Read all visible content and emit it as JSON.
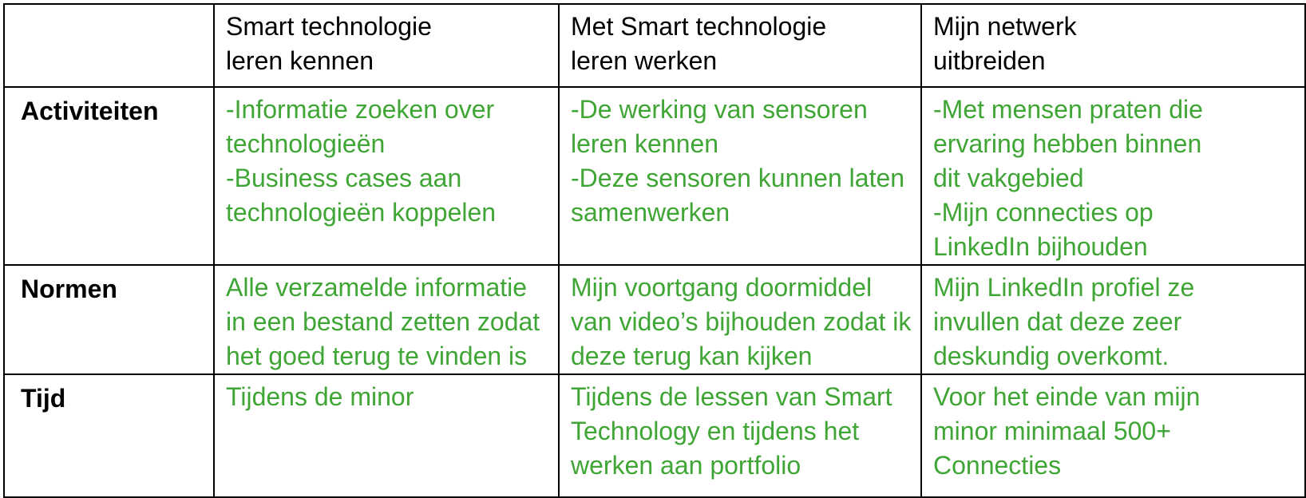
{
  "table": {
    "headers": [
      "",
      "Smart technologie\nleren kennen",
      "Met Smart technologie\nleren werken",
      "Mijn netwerk\nuitbreiden"
    ],
    "rows": [
      {
        "label": "Activiteiten",
        "cells": [
          "-Informatie zoeken over\ntechnologieën\n-Business cases aan\ntechnologieën koppelen",
          "-De werking van sensoren\nleren kennen\n-Deze sensoren kunnen laten\nsamenwerken",
          "-Met mensen praten die\nervaring hebben binnen\ndit vakgebied\n-Mijn connecties op\nLinkedIn bijhouden"
        ]
      },
      {
        "label": "Normen",
        "cells": [
          "Alle verzamelde informatie\nin een bestand zetten zodat\nhet goed terug te vinden is",
          "Mijn voortgang doormiddel\nvan video’s bijhouden zodat ik\ndeze terug kan kijken",
          "Mijn LinkedIn profiel ze\ninvullen dat deze zeer\ndeskundig overkomt."
        ]
      },
      {
        "label": "Tijd",
        "cells": [
          "Tijdens de minor",
          "Tijdens de lessen van Smart\nTechnology en tijdens het\nwerken aan portfolio",
          "Voor het einde van mijn\nminor minimaal 500+\nConnecties"
        ]
      }
    ]
  },
  "colors": {
    "cell_text": "#3fa535",
    "header_text": "#000000",
    "border": "#000000",
    "background": "#ffffff"
  }
}
